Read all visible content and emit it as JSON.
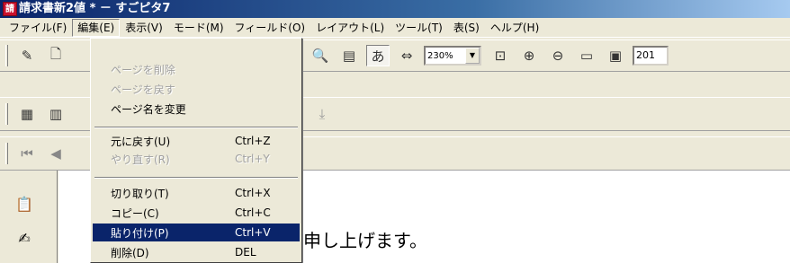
{
  "window": {
    "title": "請求書新2値 * － すごピタ7",
    "app_icon": "請"
  },
  "menubar": [
    {
      "label": "ファイル(F)"
    },
    {
      "label": "編集(E)"
    },
    {
      "label": "表示(V)"
    },
    {
      "label": "モード(M)"
    },
    {
      "label": "フィールド(O)"
    },
    {
      "label": "レイアウト(L)"
    },
    {
      "label": "ツール(T)"
    },
    {
      "label": "表(S)"
    },
    {
      "label": "ヘルプ(H)"
    }
  ],
  "edit_menu": {
    "items": [
      {
        "label": "ページを削除",
        "shortcut": "",
        "enabled": false
      },
      {
        "label": "ページを戻す",
        "shortcut": "",
        "enabled": false
      },
      {
        "label": "ページ名を変更",
        "shortcut": "",
        "enabled": true
      },
      {
        "label": "元に戻す(U)",
        "shortcut": "Ctrl+Z",
        "enabled": true
      },
      {
        "label": "やり直す(R)",
        "shortcut": "Ctrl+Y",
        "enabled": false
      },
      {
        "label": "切り取り(T)",
        "shortcut": "Ctrl+X",
        "enabled": true
      },
      {
        "label": "コピー(C)",
        "shortcut": "Ctrl+C",
        "enabled": true
      },
      {
        "label": "貼り付け(P)",
        "shortcut": "Ctrl+V",
        "enabled": true,
        "highlighted": true
      },
      {
        "label": "削除(D)",
        "shortcut": "DEL",
        "enabled": true
      }
    ]
  },
  "toolbar": {
    "zoom_value": "230%",
    "page_field": "201"
  },
  "document": {
    "visible_text": "申し上げます。"
  },
  "colors": {
    "highlight": "#0a246a",
    "title_bar": "#0a246a"
  }
}
